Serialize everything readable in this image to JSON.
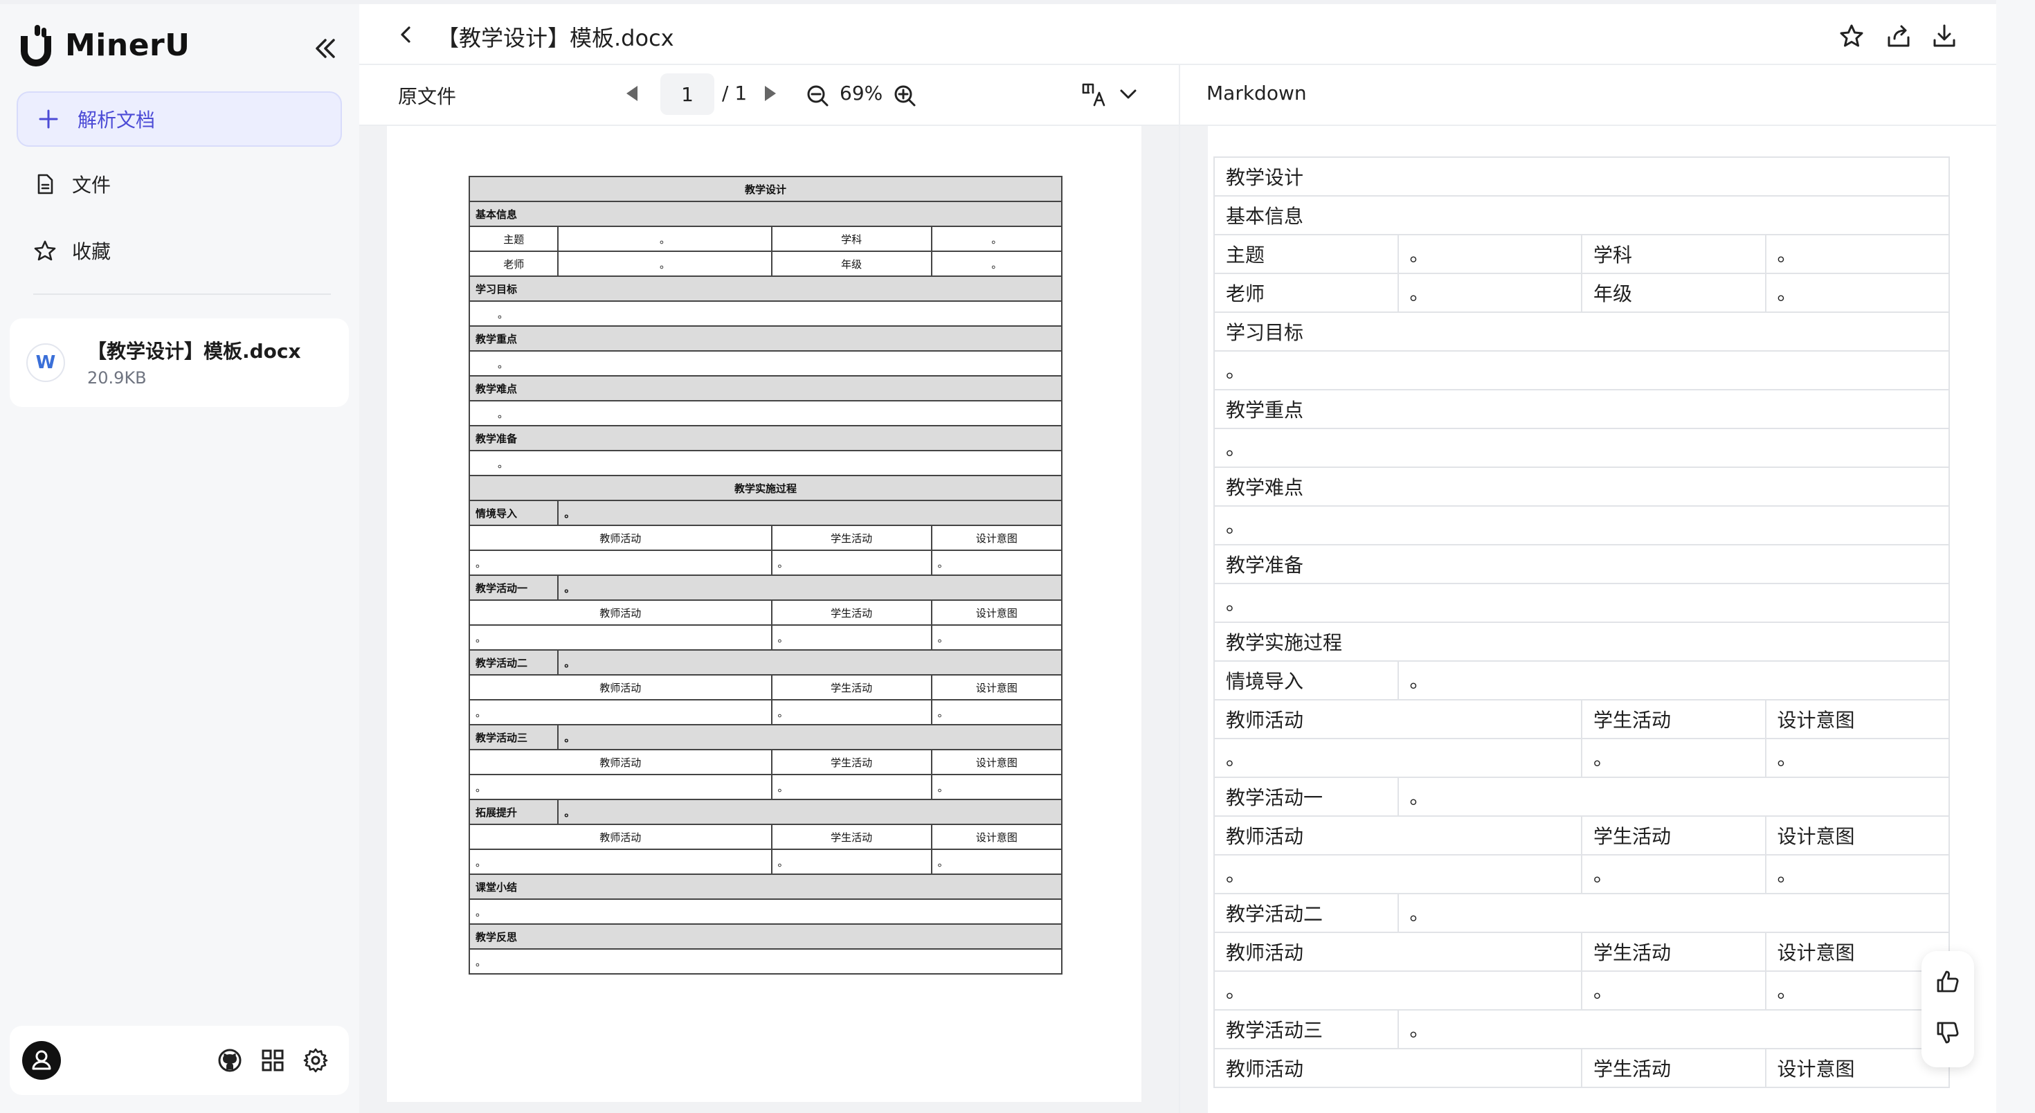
{
  "app": {
    "name": "MinerU"
  },
  "sidebar": {
    "new_button": "解析文档",
    "nav": [
      {
        "label": "文件",
        "icon": "file-icon"
      },
      {
        "label": "收藏",
        "icon": "star-icon"
      }
    ],
    "files": [
      {
        "name": "【教学设计】模板.docx",
        "size": "20.9KB",
        "type_badge": "W"
      }
    ]
  },
  "header": {
    "title": "【教学设计】模板.docx"
  },
  "toolbar": {
    "source_label": "原文件",
    "page_current": "1",
    "page_total": "/ 1",
    "zoom": "69%",
    "markdown_label": "Markdown"
  },
  "document_preview": {
    "title": "教学设计",
    "basic_info": "基本信息",
    "topic": "主题",
    "subject": "学科",
    "teacher": "老师",
    "grade": "年级",
    "objectives": "学习目标",
    "key_points": "教学重点",
    "difficulties": "教学难点",
    "preparation": "教学准备",
    "process": "教学实施过程",
    "intro": "情境导入",
    "teacher_activity": "教师活动",
    "student_activity": "学生活动",
    "design_intent": "设计意图",
    "activity1": "教学活动一",
    "activity2": "教学活动二",
    "activity3": "教学活动三",
    "extension": "拓展提升",
    "summary": "课堂小结",
    "reflection": "教学反思",
    "placeholder": "。"
  },
  "markdown_table": {
    "title": "教学设计",
    "basic_info": "基本信息",
    "topic": "主题",
    "subject": "学科",
    "teacher": "老师",
    "grade": "年级",
    "objectives": "学习目标",
    "key_points": "教学重点",
    "difficulties": "教学难点",
    "preparation": "教学准备",
    "process": "教学实施过程",
    "intro": "情境导入",
    "teacher_activity": "教师活动",
    "student_activity": "学生活动",
    "design_intent": "设计意图",
    "activity1": "教学活动一",
    "activity2": "教学活动二",
    "activity3": "教学活动三",
    "placeholder": "。"
  }
}
